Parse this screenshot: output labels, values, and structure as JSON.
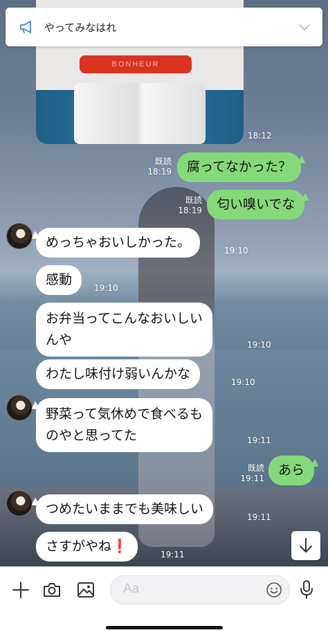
{
  "announcement": {
    "text": "やってみなはれ"
  },
  "photo": {
    "tag_text": "BONHEUR",
    "time": "18:12"
  },
  "messages": [
    {
      "dir": "out",
      "text": "腐ってなかった？",
      "read": "既読",
      "time": "18:19"
    },
    {
      "dir": "out",
      "text": "匂い嗅いでな",
      "read": "既読",
      "time": "18:19"
    },
    {
      "dir": "in",
      "text": "めっちゃおいしかった。",
      "time": "19:10"
    },
    {
      "dir": "in",
      "text": "感動",
      "time": "19:10"
    },
    {
      "dir": "in",
      "line1": "お弁当ってこんなおいしい",
      "line2": "んや",
      "time": "19:10"
    },
    {
      "dir": "in",
      "text": "わたし味付け弱いんかな",
      "time": "19:10"
    },
    {
      "dir": "in",
      "line1": "野菜って気休めで食べるも",
      "line2": "のやと思ってた",
      "time": "19:11"
    },
    {
      "dir": "out",
      "text": "あら",
      "read": "既読",
      "time": "19:11"
    },
    {
      "dir": "in",
      "text": "つめたいままでも美味しい",
      "time": "19:11"
    },
    {
      "dir": "in",
      "text": "さすがやね",
      "emoji": "❗",
      "time": "19:11"
    }
  ],
  "input": {
    "placeholder": "Aa"
  },
  "icons": {
    "announcement": "megaphone-icon",
    "expand": "chevron-down-icon",
    "scroll": "arrow-down-icon",
    "add": "plus-icon",
    "camera": "camera-icon",
    "gallery": "image-icon",
    "emoji": "smile-icon",
    "voice": "microphone-icon"
  },
  "colors": {
    "outgoing_bubble": "#86d97a",
    "incoming_bubble": "#ffffff",
    "accent": "#3a8ad6"
  }
}
